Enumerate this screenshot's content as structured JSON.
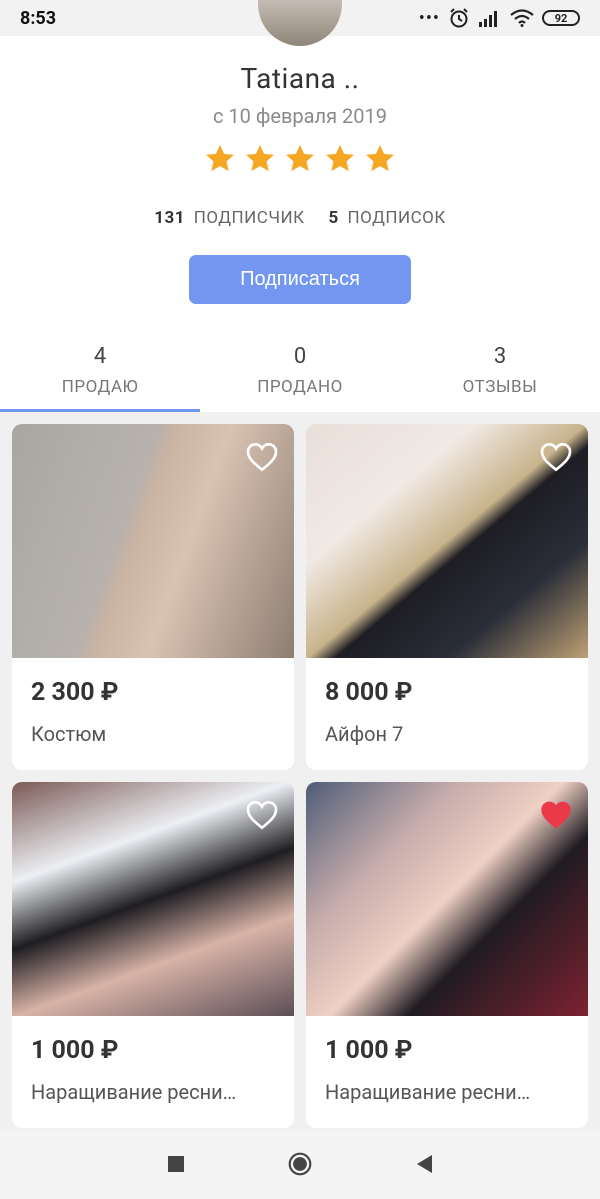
{
  "status_bar": {
    "time": "8:53",
    "dots": "•••",
    "battery": "92",
    "icons": [
      "alarm-icon",
      "signal-icon",
      "wifi-icon",
      "battery-icon"
    ]
  },
  "profile": {
    "name": "Tatiana ..",
    "since": "с 10 февраля 2019",
    "rating": 5,
    "rating_max": 5,
    "star_color": "#f5a623",
    "followers_count": "131",
    "followers_label": "ПОДПИСЧИК",
    "following_count": "5",
    "following_label": "ПОДПИСОК",
    "subscribe_label": "Подписаться",
    "accent_color": "#7397f0"
  },
  "tabs": [
    {
      "count": "4",
      "label": "ПРОДАЮ",
      "active": true
    },
    {
      "count": "0",
      "label": "ПРОДАНО",
      "active": false
    },
    {
      "count": "3",
      "label": "ОТЗЫВЫ",
      "active": false
    }
  ],
  "listings": [
    {
      "price": "2 300 ₽",
      "title": "Костюм",
      "favorited": false
    },
    {
      "price": "8 000 ₽",
      "title": "Айфон 7",
      "favorited": false
    },
    {
      "price": "1 000 ₽",
      "title": "Наращивание ресни…",
      "favorited": false
    },
    {
      "price": "1 000 ₽",
      "title": "Наращивание ресни…",
      "favorited": true
    }
  ],
  "nav": [
    "recents-icon",
    "home-icon",
    "back-icon"
  ]
}
